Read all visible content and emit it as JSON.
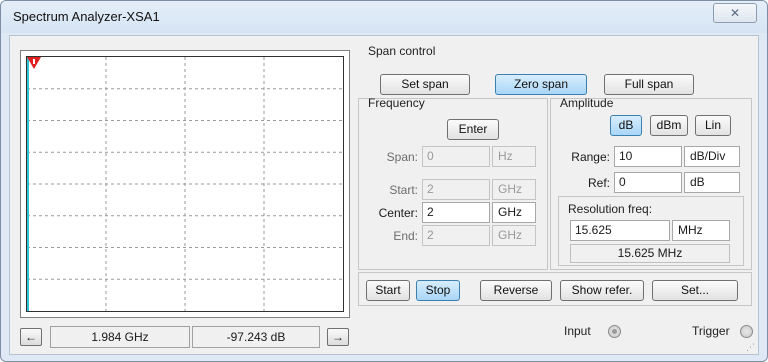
{
  "window": {
    "title": "Spectrum Analyzer-XSA1",
    "close_icon": "close-icon"
  },
  "readout": {
    "frequency": "1.984 GHz",
    "level": "-97.243 dB"
  },
  "span_control": {
    "label": "Span control",
    "set_span": "Set span",
    "zero_span": "Zero span",
    "full_span": "Full span",
    "selected": "Zero span"
  },
  "frequency": {
    "label": "Frequency",
    "enter": "Enter",
    "span": {
      "label": "Span:",
      "value": "0",
      "unit": "Hz"
    },
    "start": {
      "label": "Start:",
      "value": "2",
      "unit": "GHz"
    },
    "center": {
      "label": "Center:",
      "value": "2",
      "unit": "GHz"
    },
    "end": {
      "label": "End:",
      "value": "2",
      "unit": "GHz"
    }
  },
  "amplitude": {
    "label": "Amplitude",
    "db": "dB",
    "dbm": "dBm",
    "lin": "Lin",
    "selected": "dB",
    "range": {
      "label": "Range:",
      "value": "10",
      "unit": "dB/Div"
    },
    "ref": {
      "label": "Ref:",
      "value": "0",
      "unit": "dB"
    }
  },
  "resolution": {
    "label": "Resolution freq:",
    "value": "15.625",
    "unit": "MHz",
    "display": "15.625 MHz"
  },
  "controls": {
    "start": "Start",
    "stop": "Stop",
    "reverse": "Reverse",
    "show_refer": "Show refer.",
    "set": "Set..."
  },
  "io": {
    "input": "Input",
    "trigger": "Trigger"
  },
  "colors": {
    "trace": "#2fc4d6",
    "marker": "#e02020",
    "active_button": "#a9d6f7"
  }
}
